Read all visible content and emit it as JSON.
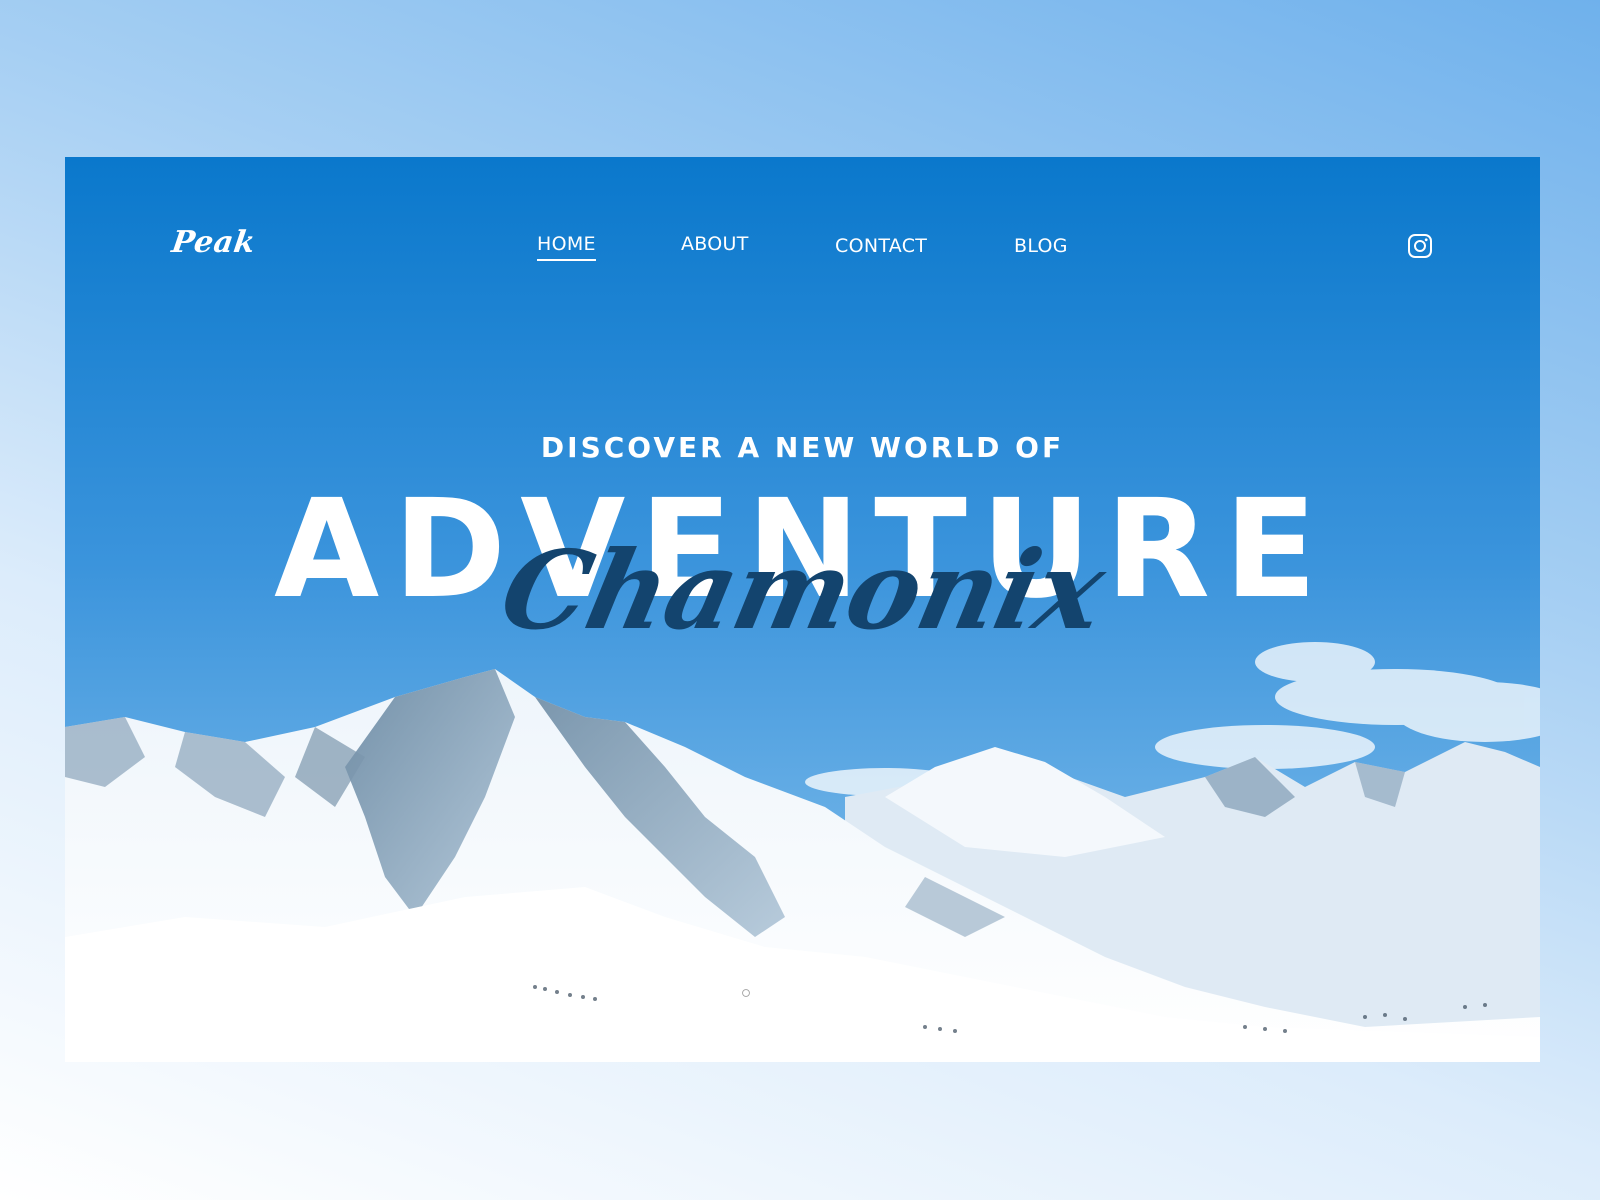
{
  "brand": {
    "logo": "Peak"
  },
  "nav": {
    "items": [
      {
        "label": "HOME",
        "active": true
      },
      {
        "label": "ABOUT",
        "active": false
      },
      {
        "label": "CONTACT",
        "active": false
      },
      {
        "label": "BLOG",
        "active": false
      }
    ],
    "social_icon": "instagram-icon"
  },
  "hero": {
    "subtitle": "DISCOVER A NEW WORLD OF",
    "title": "ADVENTURE",
    "script": "Chamonix"
  },
  "slider": {
    "total": 5,
    "active_index": 0
  },
  "colors": {
    "sky_top": "#0a78cc",
    "sky_bottom": "#7bbbe9",
    "script_text": "#13446e",
    "nav_text": "#ffffff"
  }
}
